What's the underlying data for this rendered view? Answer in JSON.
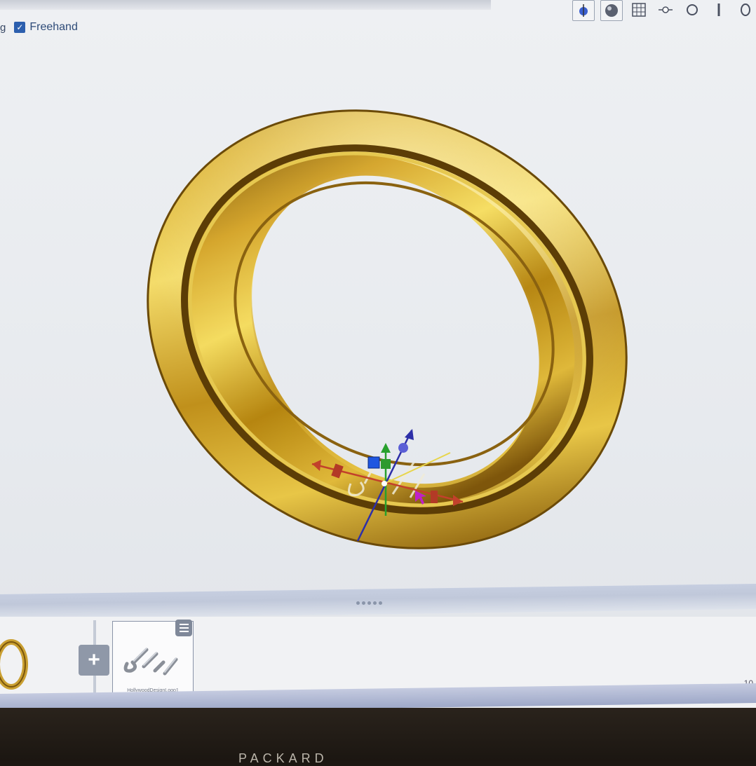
{
  "toolbar": {
    "freehand_cut_label": "g",
    "freehand_label": "Freehand",
    "freehand_checked": true,
    "icons": [
      "gumball-icon",
      "material-sphere-icon",
      "grid-icon",
      "node-icon",
      "circle-icon",
      "line-icon",
      "ring-icon"
    ]
  },
  "tray": {
    "add_label": "+",
    "thumbnail_caption": "HollywoodDesignLogo1",
    "zoom_fragment": "10"
  },
  "bezel": {
    "brand_text": "PACKARD"
  },
  "colors": {
    "gold_light": "#f6de62",
    "gold_mid": "#c99a1e",
    "gold_dark": "#6a4708",
    "axis_x": "#c2412b",
    "axis_y": "#27a02c",
    "axis_z": "#2d2fa8",
    "accent": "#2c5fae"
  }
}
